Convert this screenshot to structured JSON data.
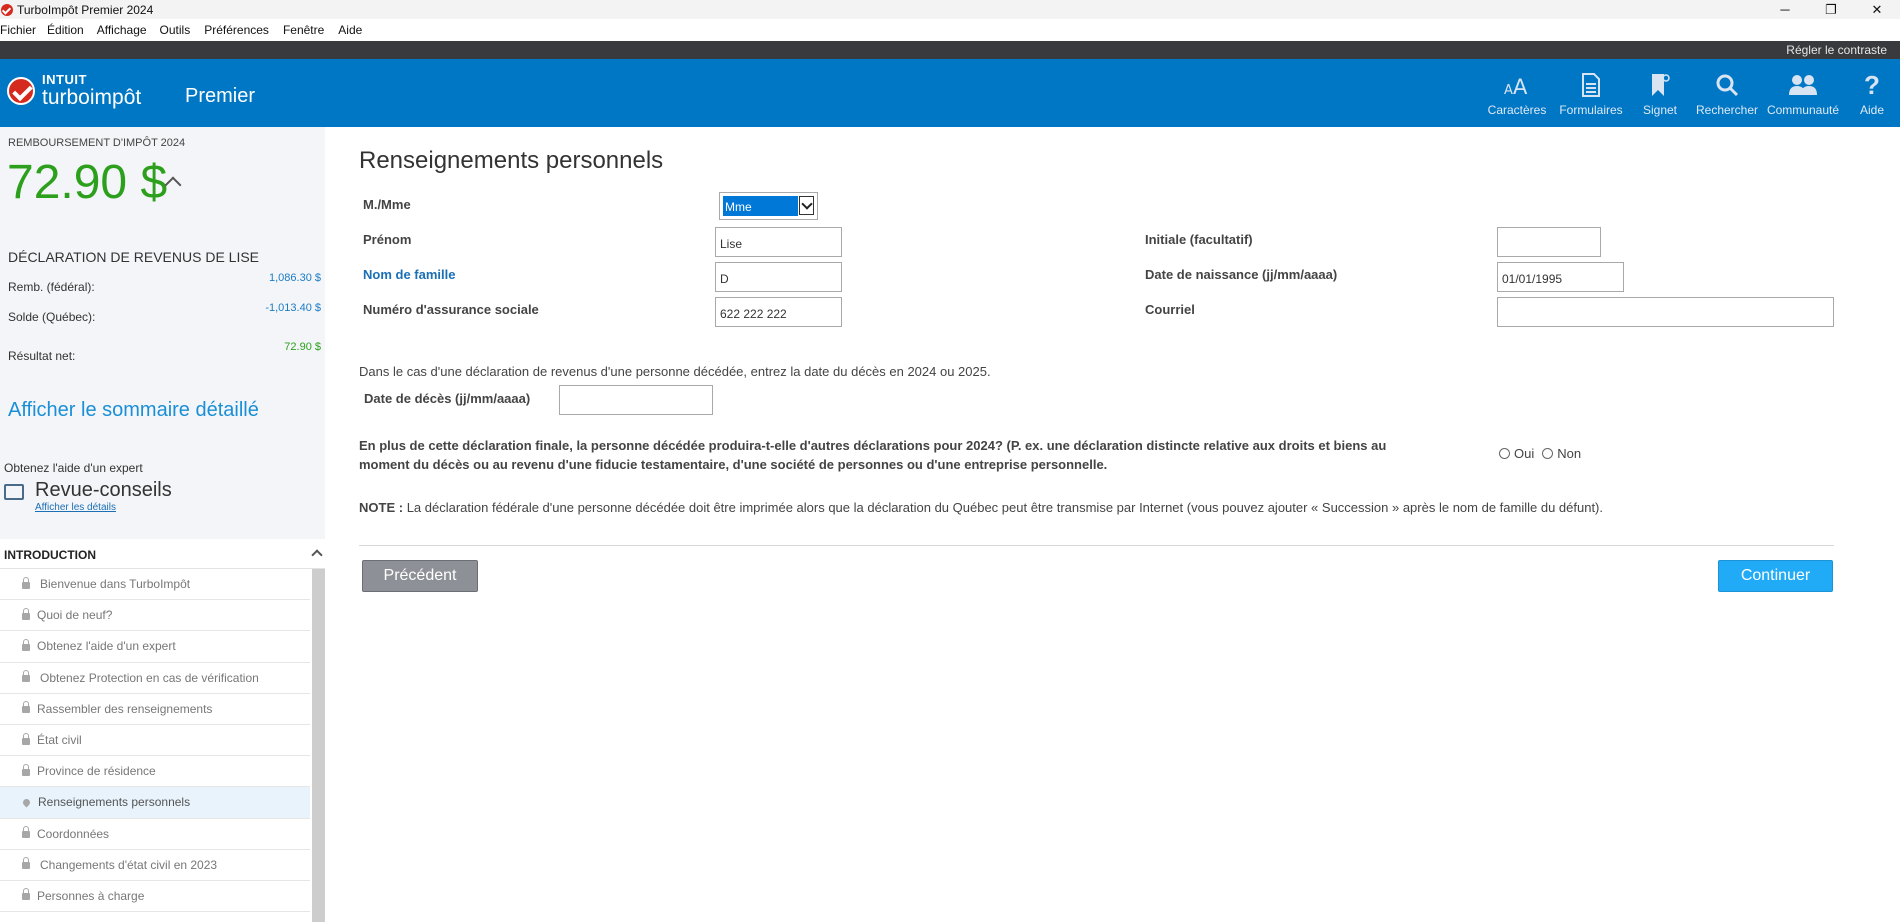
{
  "window": {
    "title": "TurboImpôt Premier 2024",
    "controls": [
      "─",
      "❐",
      "✕"
    ]
  },
  "menu": [
    "Fichier",
    "Édition",
    "Affichage",
    "Outils",
    "Préférences",
    "Fenêtre",
    "Aide"
  ],
  "contrast_link": "Régler le contraste",
  "header": {
    "logo_top": "INTUIT",
    "logo_brand": "turboimpôt",
    "edition": "Premier",
    "tools": [
      {
        "label": "Caractères",
        "icon": "font-size-icon"
      },
      {
        "label": "Formulaires",
        "icon": "document-icon"
      },
      {
        "label": "Signet",
        "icon": "bookmark-icon"
      },
      {
        "label": "Rechercher",
        "icon": "search-icon"
      },
      {
        "label": "Communauté",
        "icon": "people-icon"
      },
      {
        "label": "Aide",
        "icon": "help-icon"
      }
    ]
  },
  "sidebar": {
    "refund_label": "REMBOURSEMENT D'IMPÔT 2024",
    "refund_amount": "72.90 $",
    "declaration_title": "DÉCLARATION DE REVENUS DE LISE",
    "rows": [
      {
        "label": "Remb. (fédéral):",
        "value": "1,086.30 $"
      },
      {
        "label": "Solde (Québec):",
        "value": "-1,013.40 $"
      },
      {
        "label": "Résultat net:",
        "value": "72.90 $"
      }
    ],
    "summary_link": "Afficher le sommaire détaillé",
    "expert_label": "Obtenez l'aide d'un expert",
    "revue_title": "Revue-conseils",
    "revue_link": "Afficher les détails",
    "nav_header": "INTRODUCTION",
    "nav_items": [
      "Bienvenue dans TurboImpôt",
      "Quoi de neuf?",
      "Obtenez l'aide d'un expert",
      "Obtenez Protection en cas de vérification",
      "Rassembler des renseignements",
      "État civil",
      "Province de résidence",
      "Renseignements personnels",
      "Coordonnées",
      "Changements d'état civil en 2023",
      "Personnes à charge"
    ]
  },
  "form": {
    "title": "Renseignements personnels",
    "salutation_label": "M./Mme",
    "salutation_value": "Mme",
    "firstname_label": "Prénom",
    "firstname_value": "Lise",
    "initial_label": "Initiale (facultatif)",
    "initial_value": "",
    "lastname_label": "Nom de famille",
    "lastname_value": "D",
    "dob_label": "Date de naissance (jj/mm/aaaa)",
    "dob_value": "01/01/1995",
    "sin_label": "Numéro d'assurance sociale",
    "sin_value": "622 222 222",
    "email_label": "Courriel",
    "email_value": "",
    "deceased_info": "Dans le cas d'une déclaration de revenus d'une personne décédée, entrez la date du décès en 2024 ou 2025.",
    "death_date_label": "Date de décès (jj/mm/aaaa)",
    "death_date_value": "",
    "question_line1": "En plus de cette déclaration finale, la personne décédée produira-t-elle d'autres déclarations pour 2024? (P. ex. une déclaration distincte relative aux droits et biens au",
    "question_line2": "moment du décès ou au revenu d'une fiducie testamentaire, d'une société de personnes ou d'une entreprise personnelle.",
    "yes_label": "Oui",
    "no_label": "Non",
    "note_prefix": "NOTE :",
    "note_text": "La déclaration fédérale d'une personne décédée doit être imprimée alors que la déclaration du Québec peut être transmise par Internet (vous pouvez ajouter « Succession » après le nom de famille du défunt).",
    "prev_button": "Précédent",
    "next_button": "Continuer"
  }
}
